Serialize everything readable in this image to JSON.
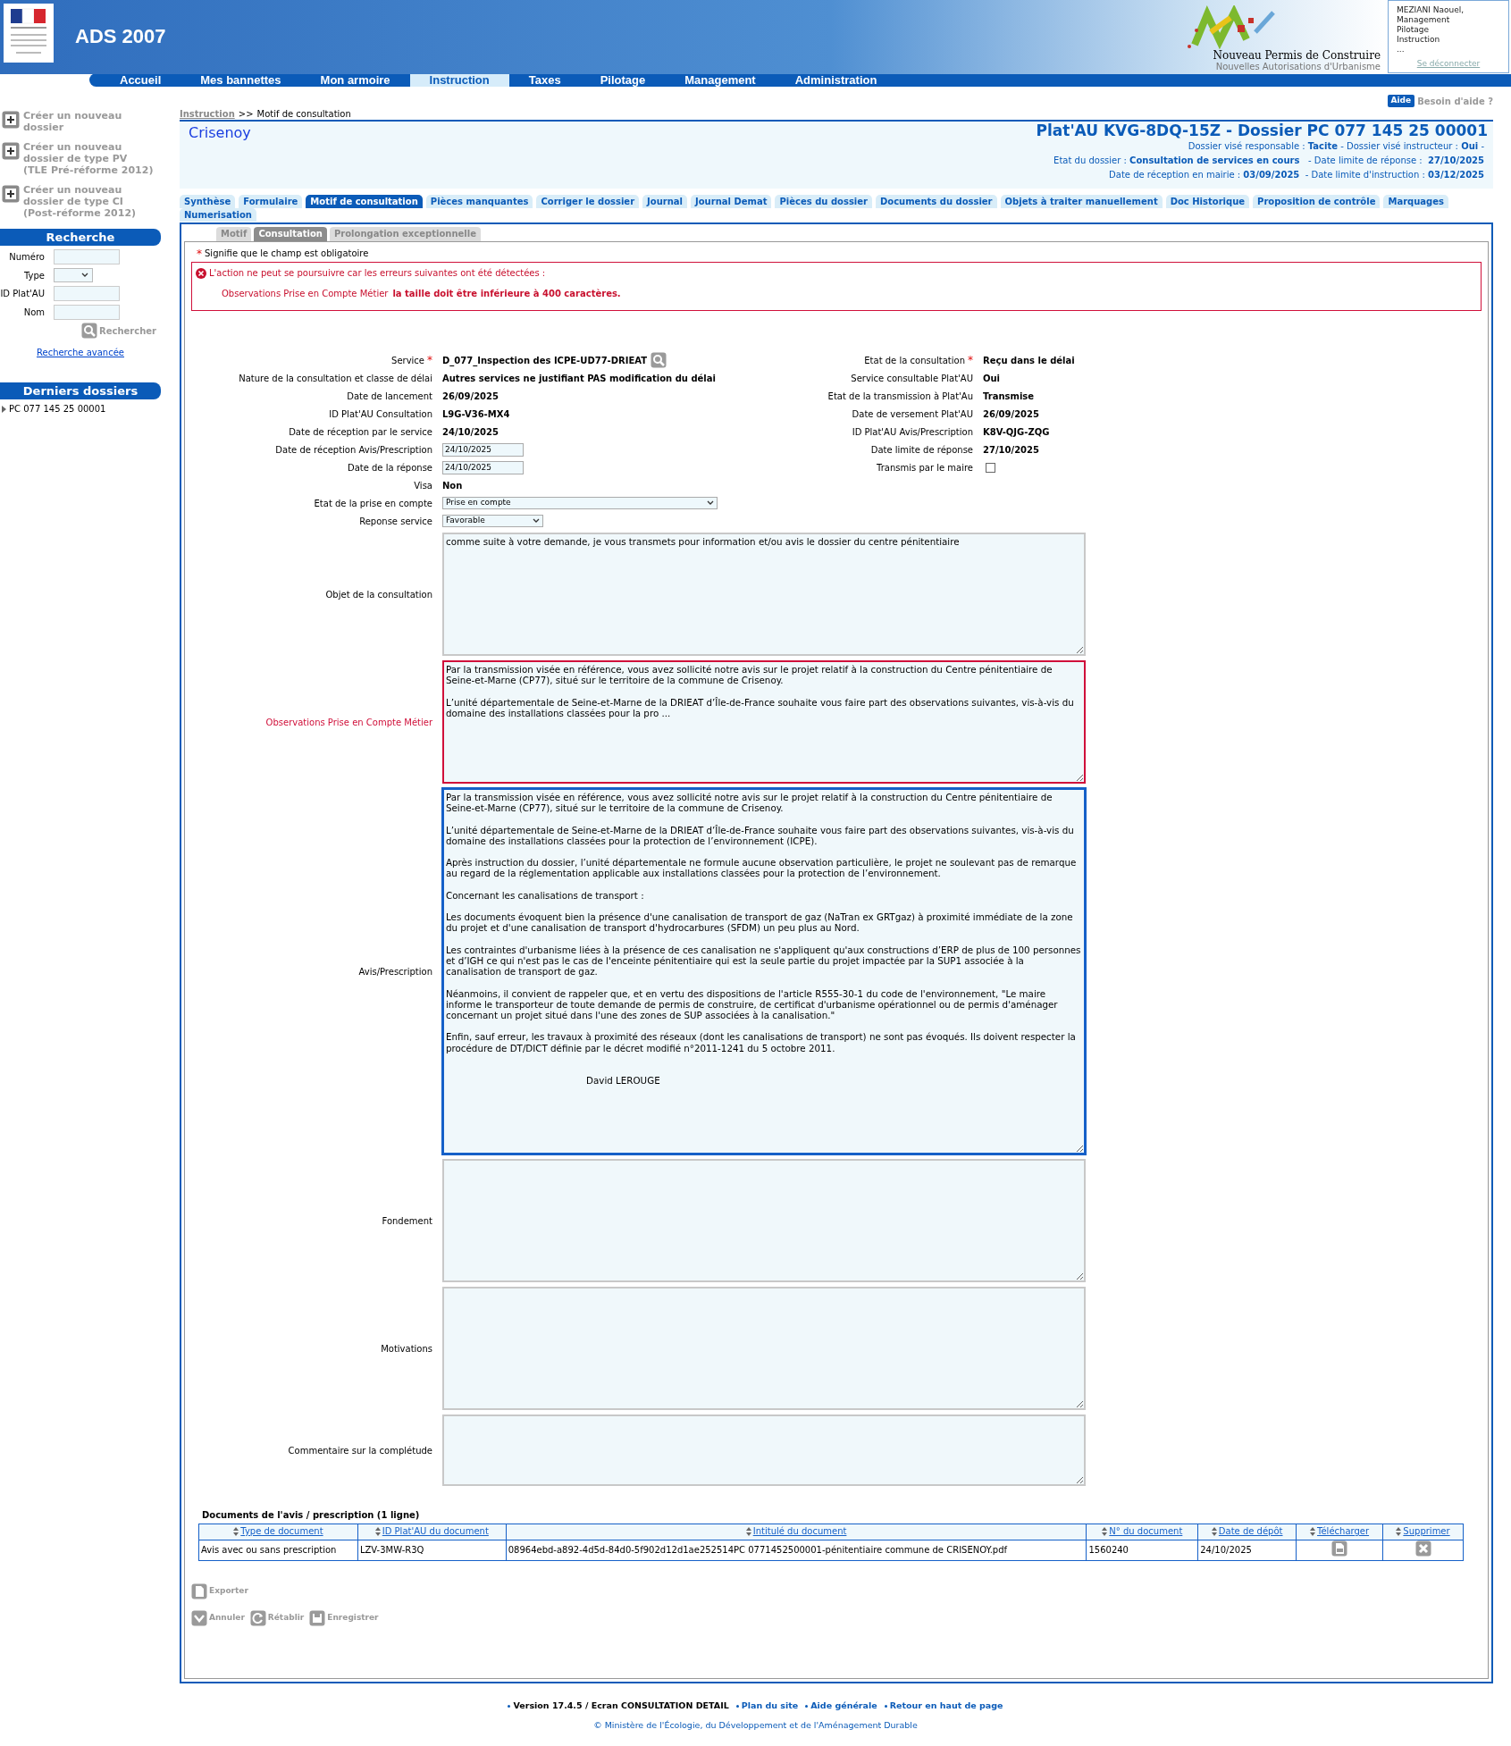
{
  "header": {
    "app_title": "ADS 2007",
    "brand_title": "Nouveau Permis de Construire",
    "brand_subtitle": "Nouvelles Autorisations d'Urbanisme",
    "user_lines": [
      "MEZIANI Naouel,",
      "Management",
      "Pilotage",
      "Instruction",
      "..."
    ],
    "logout": "Se déconnecter"
  },
  "nav": [
    {
      "label": "Accueil",
      "selected": false
    },
    {
      "label": "Mes bannettes",
      "selected": false
    },
    {
      "label": "Mon armoire",
      "selected": false
    },
    {
      "label": "Instruction",
      "selected": true
    },
    {
      "label": "Taxes",
      "selected": false
    },
    {
      "label": "Pilotage",
      "selected": false
    },
    {
      "label": "Management",
      "selected": false
    },
    {
      "label": "Administration",
      "selected": false
    }
  ],
  "help": {
    "badge": "Aide",
    "label": "Besoin d'aide ?"
  },
  "sidebar": {
    "create_links": [
      {
        "label": "Créer un nouveau dossier"
      },
      {
        "label": "Créer un nouveau dossier de type PV",
        "sublabel": "(TLE Pré-réforme 2012)"
      },
      {
        "label": "Créer un nouveau dossier de type CI",
        "sublabel": "(Post-réforme 2012)"
      }
    ],
    "search": {
      "title": "Recherche",
      "fields": [
        {
          "label": "Numéro",
          "kind": "input"
        },
        {
          "label": "Type",
          "kind": "select"
        },
        {
          "label": "ID Plat'AU",
          "kind": "input"
        },
        {
          "label": "Nom",
          "kind": "input"
        }
      ],
      "button": "Rechercher",
      "advanced": "Recherche avancée"
    },
    "recent": {
      "title": "Derniers dossiers",
      "items": [
        "PC 077 145 25 00001"
      ]
    }
  },
  "breadcrumb": {
    "parent": "Instruction",
    "separator": ">>",
    "current": "Motif de consultation"
  },
  "dossier": {
    "commune": "Crisenoy",
    "title": "Plat'AU KVG-8DQ-15Z - Dossier PC 077 145 25 00001",
    "info": [
      "Dossier visé responsable : **Tacite** - Dossier visé instructeur : **Oui** -",
      "Etat du dossier : **Consultation de services en cours**   - Date limite de réponse :  **27/10/2025**",
      "Date de réception en mairie : **03/09/2025**  - Date limite d'instruction : **03/12/2025**"
    ]
  },
  "tabs": [
    {
      "label": "Synthèse",
      "selected": false
    },
    {
      "label": "Formulaire",
      "selected": false
    },
    {
      "label": "Motif de consultation",
      "selected": true
    },
    {
      "label": "Pièces manquantes",
      "selected": false
    },
    {
      "label": "Corriger le dossier",
      "selected": false
    },
    {
      "label": "Journal",
      "selected": false
    },
    {
      "label": "Journal Demat",
      "selected": false
    },
    {
      "label": "Pièces du dossier",
      "selected": false
    },
    {
      "label": "Documents du dossier",
      "selected": false
    },
    {
      "label": "Objets à traiter manuellement",
      "selected": false
    },
    {
      "label": "Doc Historique",
      "selected": false
    },
    {
      "label": "Proposition de contrôle",
      "selected": false
    },
    {
      "label": "Marquages",
      "selected": false
    },
    {
      "label": "Numerisation",
      "selected": false
    }
  ],
  "subtabs": [
    {
      "label": "Motif",
      "selected": false
    },
    {
      "label": "Consultation",
      "selected": true
    },
    {
      "label": "Prolongation exceptionnelle",
      "selected": false
    }
  ],
  "required_note": {
    "mark": "*",
    "text": "Signifie que le champ est obligatoire"
  },
  "error": {
    "title": "L'action ne peut se poursuivre car les erreurs suivantes ont été détectées :",
    "field": "Observations Prise en Compte Métier",
    "message": "la taille doit être inférieure à 400 caractères."
  },
  "fields_left": [
    {
      "label": "Service",
      "required": true,
      "kind": "lookup",
      "value": "D_077_Inspection des ICPE-UD77-DRIEAT"
    },
    {
      "label": "Nature de la consultation et classe de délai",
      "required": false,
      "kind": "text",
      "value": "Autres services ne justifiant PAS modification du délai"
    },
    {
      "label": "Date de lancement",
      "required": false,
      "kind": "text",
      "value": "26/09/2025"
    },
    {
      "label": "ID Plat'AU Consultation",
      "required": false,
      "kind": "text",
      "value": "L9G-V36-MX4"
    },
    {
      "label": "Date de réception par le service",
      "required": false,
      "kind": "text",
      "value": "24/10/2025"
    },
    {
      "label": "Date de réception Avis/Prescription",
      "required": false,
      "kind": "input",
      "value": "24/10/2025"
    },
    {
      "label": "Date de la réponse",
      "required": false,
      "kind": "input",
      "value": "24/10/2025"
    },
    {
      "label": "Visa",
      "required": false,
      "kind": "text",
      "value": "Non"
    },
    {
      "label": "Etat de la prise en compte",
      "required": false,
      "kind": "select",
      "value": "Prise en compte"
    },
    {
      "label": "Reponse service",
      "required": false,
      "kind": "select",
      "value": "Favorable"
    }
  ],
  "fields_right": [
    {
      "label": "Etat de la consultation",
      "required": true,
      "kind": "text",
      "value": "Reçu dans le délai"
    },
    {
      "label": "Service consultable Plat'AU",
      "required": false,
      "kind": "text",
      "value": "Oui"
    },
    {
      "label": "Etat de la transmission à Plat'Au",
      "required": false,
      "kind": "text",
      "value": "Transmise"
    },
    {
      "label": "Date de versement Plat'AU",
      "required": false,
      "kind": "text",
      "value": "26/09/2025"
    },
    {
      "label": "ID Plat'AU Avis/Prescription",
      "required": false,
      "kind": "text",
      "value": "K8V-QJG-ZQG"
    },
    {
      "label": "Date limite de réponse",
      "required": false,
      "kind": "text",
      "value": "27/10/2025"
    },
    {
      "label": "Transmis par le maire",
      "required": false,
      "kind": "checkbox",
      "checked": false
    }
  ],
  "text_areas": [
    {
      "label": "Objet de la consultation",
      "invalid": false,
      "focused": false,
      "value": "comme suite à votre demande, je vous transmets pour information et/ou avis le dossier du centre pénitentiaire"
    },
    {
      "label": "Observations Prise en Compte Métier",
      "invalid": true,
      "focused": false,
      "value": "Par la transmission visée en référence, vous avez sollicité notre avis sur le projet relatif à la construction du Centre pénitentiaire de Seine-et-Marne (CP77), situé sur le territoire de la commune de Crisenoy.\n\nL’unité départementale de Seine-et-Marne de la DRIEAT d’Île-de-France souhaite vous faire part des observations suivantes, vis-à-vis du domaine des installations classées pour la pro ..."
    },
    {
      "label": "Avis/Prescription",
      "invalid": false,
      "focused": true,
      "value": "Par la transmission visée en référence, vous avez sollicité notre avis sur le projet relatif à la construction du Centre pénitentiaire de Seine-et-Marne (CP77), situé sur le territoire de la commune de Crisenoy.\n\nL’unité départementale de Seine-et-Marne de la DRIEAT d’Île-de-France souhaite vous faire part des observations suivantes, vis-à-vis du domaine des installations classées pour la protection de l’environnement (ICPE).\n\nAprès instruction du dossier, l’unité départementale ne formule aucune observation particulière, le projet ne soulevant pas de remarque au regard de la réglementation applicable aux installations classées pour la protection de l’environnement.\n\nConcernant les canalisations de transport :\n\nLes documents évoquent bien la présence d'une canalisation de transport de gaz (NaTran ex GRTgaz) à proximité immédiate de la zone du projet et d'une canalisation de transport d'hydrocarbures (SFDM) un peu plus au Nord.\n\nLes contraintes d'urbanisme liées à la présence de ces canalisation ne s'appliquent qu'aux constructions d’ERP de plus de 100 personnes et d’IGH ce qui n'est pas le cas de l'enceinte pénitentiaire qui est la seule partie du projet impactée par la SUP1 associée à la canalisation de transport de gaz.\n\nNéanmoins, il convient de rappeler que, et en vertu des dispositions de l'article R555-30-1 du code de l'environnement, \"Le maire informe le transporteur de toute demande de permis de construire, de certificat d'urbanisme opérationnel ou de permis d'aménager concernant un projet situé dans l'une des zones de SUP associées à la canalisation.\"\n\nEnfin, sauf erreur, les travaux à proximité des réseaux (dont les canalisations de transport) ne sont pas évoqués. Ils doivent respecter la procédure de DT/DICT définie par le décret modifié n°2011-1241 du 5 octobre 2011.\n\n\n                                                David LEROUGE"
    },
    {
      "label": "Fondement",
      "invalid": false,
      "focused": false
    },
    {
      "label": "Motivations",
      "invalid": false,
      "focused": false
    },
    {
      "label": "Commentaire sur la complétude",
      "invalid": false,
      "focused": false
    }
  ],
  "documents": {
    "title": "Documents de l'avis / prescription (1 ligne)",
    "columns": [
      "Type de document",
      "ID Plat'AU du document",
      "Intitulé du document",
      "N° du document",
      "Date de dépôt",
      "Télécharger",
      "Supprimer"
    ],
    "rows": [
      [
        "Avis avec ou sans prescription",
        "LZV-3MW-R3Q",
        "08964ebd-a892-4d5d-84d0-5f902d12d1ae252514PC 0771452500001-pénitentiaire commune de CRISENOY.pdf",
        "1560240",
        "24/10/2025"
      ]
    ]
  },
  "export": {
    "label": "Exporter",
    "disabled": true
  },
  "actions": [
    {
      "label": "Annuler",
      "kind": "cancel",
      "disabled": true
    },
    {
      "label": "Rétablir",
      "kind": "reset",
      "disabled": true
    },
    {
      "label": "Enregistrer",
      "kind": "save",
      "disabled": true
    }
  ],
  "footer": {
    "links": [
      "Version 17.4.5 / Ecran CONSULTATION DETAIL",
      "Plan du site",
      "Aide générale",
      "Retour en haut de page"
    ],
    "copyright": "© Ministère de l'Écologie, du Développement et de l'Aménagement Durable"
  }
}
